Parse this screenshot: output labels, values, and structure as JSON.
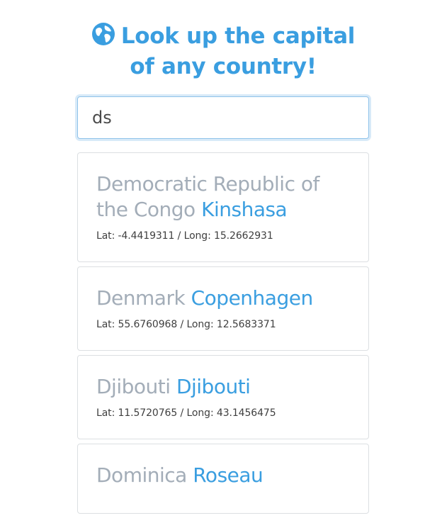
{
  "header": {
    "icon": "globe-icon",
    "title": "Look up the capital of any country!"
  },
  "search": {
    "value": "ds",
    "placeholder": ""
  },
  "results": [
    {
      "country": "Democratic Republic of the Congo",
      "capital": "Kinshasa",
      "coords": "Lat: -4.4419311 / Long: 15.2662931"
    },
    {
      "country": "Denmark",
      "capital": "Copenhagen",
      "coords": "Lat: 55.6760968 / Long: 12.5683371"
    },
    {
      "country": "Djibouti",
      "capital": "Djibouti",
      "coords": "Lat: 11.5720765 / Long: 43.1456475"
    },
    {
      "country": "Dominica",
      "capital": "Roseau",
      "coords": ""
    }
  ],
  "colors": {
    "accent": "#3a9ee0",
    "muted": "#a3adb8",
    "border": "#dcdfe2"
  }
}
